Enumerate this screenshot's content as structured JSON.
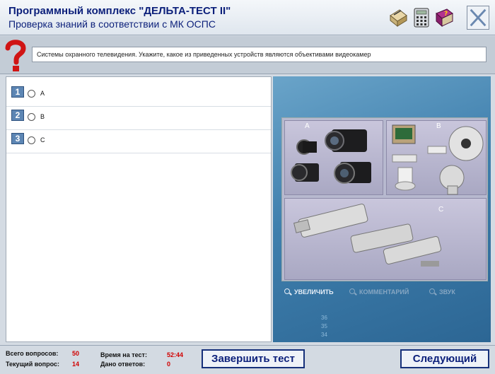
{
  "header": {
    "title": "Программный комплекс \"ДЕЛЬТА-ТЕСТ II\"",
    "subtitle": "Проверка знаний в соответствии с МК ОСПС"
  },
  "toolbar": {
    "icons": [
      "notes-icon",
      "calculator-icon",
      "help-book-icon",
      "close-icon"
    ]
  },
  "question": {
    "text": "Системы охранного телевидения. Укажите, какое из приведенных устройств являются объективами видеокамер"
  },
  "answers": [
    {
      "number": "1",
      "label": "A"
    },
    {
      "number": "2",
      "label": "B"
    },
    {
      "number": "3",
      "label": "C"
    }
  ],
  "picture": {
    "letters": {
      "a": "A",
      "b": "B",
      "c": "C"
    },
    "media_buttons": {
      "zoom": "УВЕЛИЧИТЬ",
      "comment": "КОММЕНТАРИЙ",
      "sound": "ЗВУК"
    },
    "side_numbers": [
      "36",
      "35",
      "34"
    ]
  },
  "stats": {
    "total_label": "Всего вопросов:",
    "total_value": "50",
    "current_label": "Текущий вопрос:",
    "current_value": "14",
    "time_label": "Время на тест:",
    "time_value": "52:44",
    "answered_label": "Дано ответов:",
    "answered_value": "0"
  },
  "buttons": {
    "finish": "Завершить тест",
    "next": "Следующий"
  },
  "colors": {
    "title": "#0b1f7a",
    "accent": "#5d86b4",
    "stat_value": "#d10000"
  }
}
